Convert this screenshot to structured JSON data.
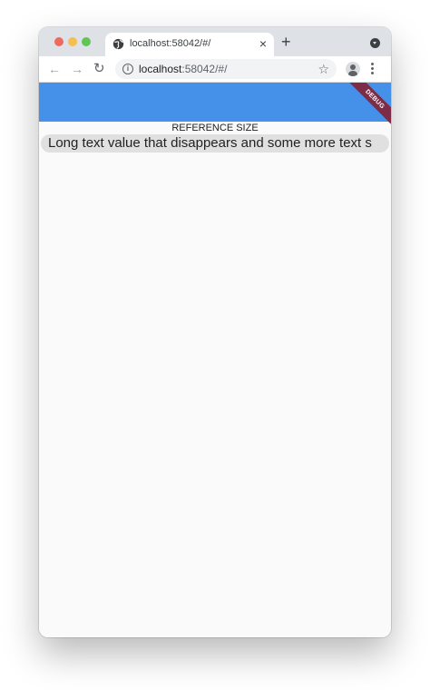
{
  "browser": {
    "tab": {
      "title": "localhost:58042/#/",
      "close_glyph": "×"
    },
    "new_tab_glyph": "+",
    "nav": {
      "back_glyph": "←",
      "forward_glyph": "→",
      "reload_glyph": "↻"
    },
    "address_bar": {
      "info_glyph": "i",
      "url_host": "localhost",
      "url_rest": ":58042/#/"
    },
    "star_glyph": "☆",
    "icons": [
      "globe-icon",
      "close-icon",
      "plus-icon",
      "tab-search-icon",
      "back-arrow-icon",
      "forward-arrow-icon",
      "reload-icon",
      "info-icon",
      "star-icon",
      "profile-icon",
      "kebab-menu-icon"
    ]
  },
  "app": {
    "appbar_color": "#4590e9",
    "debug_banner": "DEBUG",
    "debug_banner_color": "#7d2b46",
    "reference_label": "REFERENCE SIZE",
    "long_text": "Long text value that disappears and some more text s",
    "pill_color": "#e0e0e0"
  }
}
